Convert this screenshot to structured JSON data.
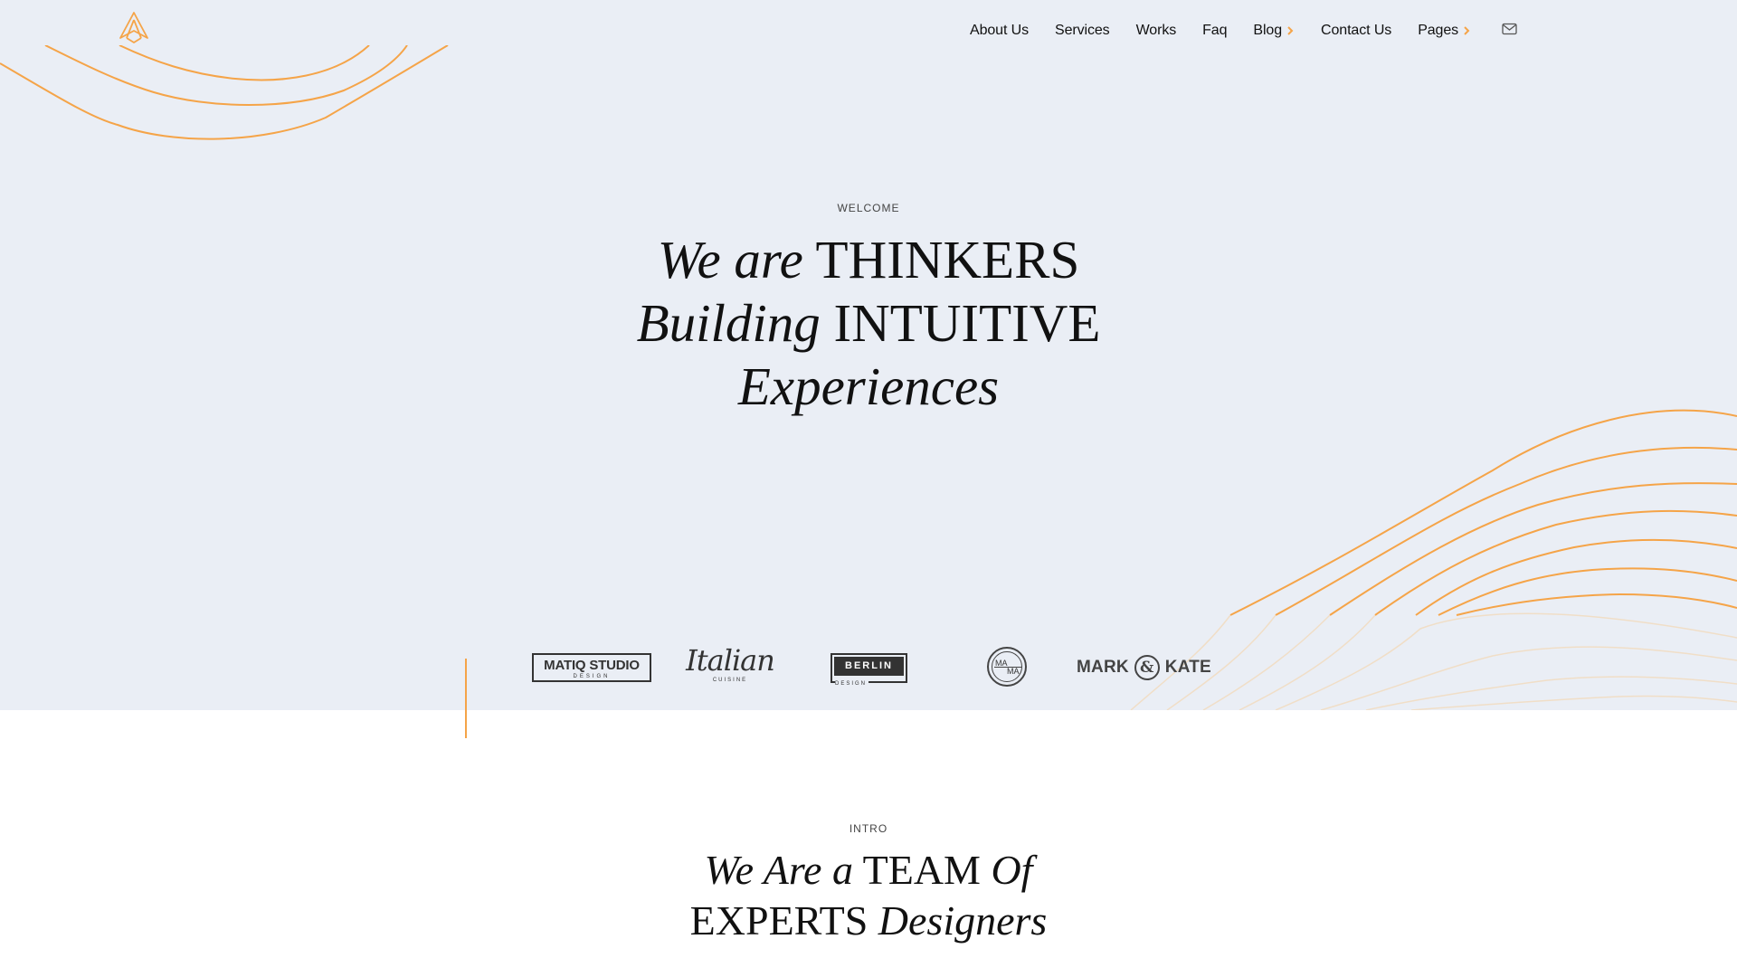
{
  "nav": {
    "items": [
      {
        "label": "About Us",
        "has_submenu": false
      },
      {
        "label": "Services",
        "has_submenu": false
      },
      {
        "label": "Works",
        "has_submenu": false
      },
      {
        "label": "Faq",
        "has_submenu": false
      },
      {
        "label": "Blog",
        "has_submenu": true
      },
      {
        "label": "Contact Us",
        "has_submenu": false
      },
      {
        "label": "Pages",
        "has_submenu": true
      }
    ],
    "mail_icon": "envelope-icon",
    "accent_color": "#f5a448"
  },
  "hero": {
    "eyebrow": "WELCOME",
    "line1_italic": "We are",
    "line1_caps": "THINKERS",
    "line2_italic": "Building",
    "line2_caps": "INTUITIVE",
    "line3_italic": "Experiences",
    "background_color": "#eaeef5"
  },
  "clients": {
    "matiq": {
      "name": "MATIQ STUDIO",
      "sub": "DESIGN"
    },
    "italian": {
      "name": "Italian",
      "sub": "CUISINE"
    },
    "berlin": {
      "name": "BERLIN",
      "sub": "DESIGN"
    },
    "mama": {
      "top": "MA",
      "bottom": "MA"
    },
    "markkate": {
      "left": "MARK",
      "amp": "&",
      "right": "KATE"
    }
  },
  "intro": {
    "eyebrow": "INTRO",
    "line1_italic_a": "We Are a",
    "line1_caps": "TEAM",
    "line1_italic_b": "Of",
    "line2_caps": "EXPERTS",
    "line2_italic": "Designers"
  }
}
